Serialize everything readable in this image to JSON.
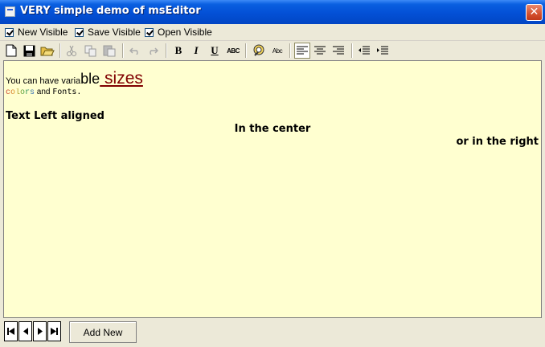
{
  "window": {
    "title": "VERY simple demo of msEditor",
    "close_glyph": "✕"
  },
  "options": [
    {
      "label": "New Visible",
      "checked": true
    },
    {
      "label": "Save Visible",
      "checked": true
    },
    {
      "label": "Open Visible",
      "checked": true
    }
  ],
  "toolbar": {
    "icons": [
      "new-document-icon",
      "save-icon",
      "open-folder-icon",
      "cut-icon",
      "copy-icon",
      "paste-icon",
      "undo-icon",
      "redo-icon",
      "bold-icon",
      "italic-icon",
      "underline-icon",
      "strikethrough-icon",
      "spell-check-icon",
      "font-icon",
      "align-left-icon",
      "align-center-icon",
      "align-right-icon",
      "decrease-indent-icon",
      "increase-indent-icon"
    ],
    "bold_label": "B",
    "italic_label": "I",
    "underline_label": "U",
    "strike_label": "ABC",
    "font_label": "Abc"
  },
  "editor": {
    "background": "#ffffd0",
    "line1_small": "You can have varia",
    "line1_mid": "ble",
    "line1_large": " sizes",
    "line2_colors": "colors",
    "line2_and": " and ",
    "line2_fonts": "Fonts.",
    "left_text": "Text Left aligned",
    "center_text": "In the center",
    "right_text": "or in the right"
  },
  "navigator": {
    "add_new": "Add New"
  },
  "colors": {
    "sizes_text": "#800000",
    "title_bar": "#0350d6",
    "close_button": "#d4502e"
  }
}
